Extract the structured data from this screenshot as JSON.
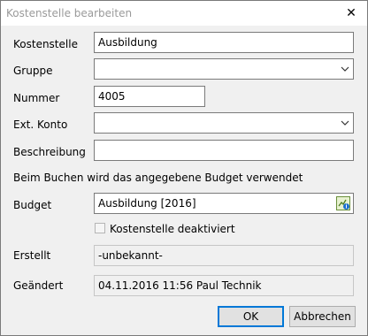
{
  "dialog": {
    "title": "Kostenstelle bearbeiten",
    "close_glyph": "✕"
  },
  "form": {
    "kostenstelle": {
      "label": "Kostenstelle",
      "value": "Ausbildung"
    },
    "gruppe": {
      "label": "Gruppe",
      "value": ""
    },
    "nummer": {
      "label": "Nummer",
      "value": "4005"
    },
    "ext_konto": {
      "label": "Ext. Konto",
      "value": ""
    },
    "beschreibung": {
      "label": "Beschreibung",
      "value": ""
    },
    "budget_hint": "Beim Buchen wird das angegebene Budget verwendet",
    "budget": {
      "label": "Budget",
      "value": "Ausbildung [2016]"
    },
    "deaktiviert": {
      "label": "Kostenstelle deaktiviert",
      "checked": false
    },
    "erstellt": {
      "label": "Erstellt",
      "value": "-unbekannt-"
    },
    "geaendert": {
      "label": "Geändert",
      "value": "04.11.2016 11:56 Paul Technik"
    }
  },
  "buttons": {
    "ok": "OK",
    "cancel": "Abbrechen"
  },
  "colors": {
    "accent": "#0078d7",
    "dialog_bg": "#f0f0f0",
    "title_text": "#9a9a9a"
  }
}
